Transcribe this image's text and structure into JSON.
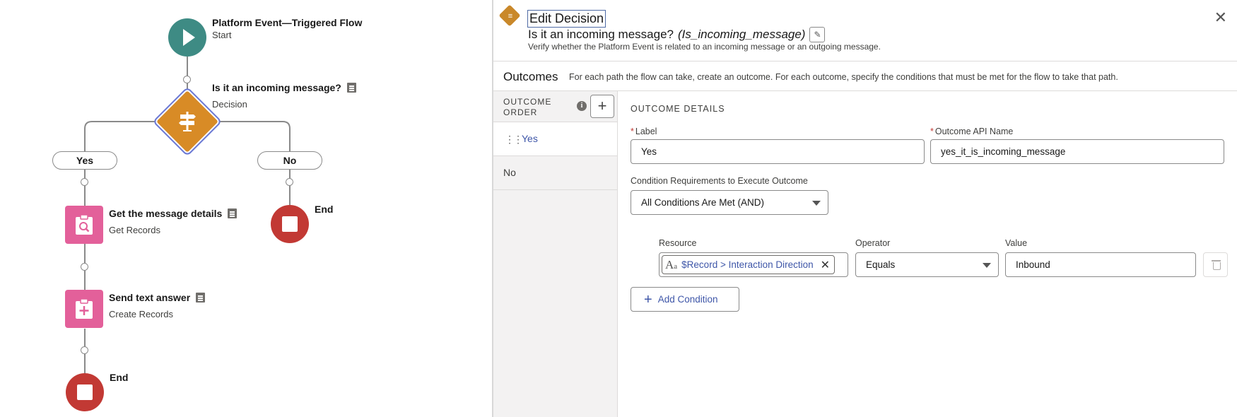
{
  "flow": {
    "start": {
      "title": "Platform Event—Triggered Flow",
      "subtitle": "Start"
    },
    "decision": {
      "title": "Is it an incoming message?",
      "subtitle": "Decision"
    },
    "branch_yes": "Yes",
    "branch_no": "No",
    "get_records": {
      "title": "Get the message details",
      "subtitle": "Get Records"
    },
    "create_records": {
      "title": "Send text answer",
      "subtitle": "Create Records"
    },
    "end_right": "End",
    "end_bottom": "End"
  },
  "panel": {
    "title": "Edit Decision",
    "element_label": "Is it an incoming message?",
    "element_api": "(Is_incoming_message)",
    "description": "Verify whether the Platform Event is related to an incoming message or an outgoing message.",
    "outcomes_title": "Outcomes",
    "outcomes_desc": "For each path the flow can take, create an outcome. For each outcome, specify the conditions that must be met for the flow to take that path.",
    "order_header": "OUTCOME ORDER",
    "outcome_items": [
      "Yes",
      "No"
    ],
    "details_title": "OUTCOME DETAILS",
    "label_field": {
      "label": "Label",
      "value": "Yes"
    },
    "api_field": {
      "label": "Outcome API Name",
      "value": "yes_it_is_incoming_message"
    },
    "condition_req": {
      "label": "Condition Requirements to Execute Outcome",
      "value": "All Conditions Are Met (AND)"
    },
    "condition": {
      "resource_label": "Resource",
      "resource_value": "$Record > Interaction Direction",
      "operator_label": "Operator",
      "operator_value": "Equals",
      "value_label": "Value",
      "value_value": "Inbound"
    },
    "add_condition": "Add Condition"
  },
  "colors": {
    "start": "#3e8b84",
    "decision": "#d88b26",
    "records": "#e3609a",
    "end": "#c23934",
    "link": "#3e56a8"
  }
}
